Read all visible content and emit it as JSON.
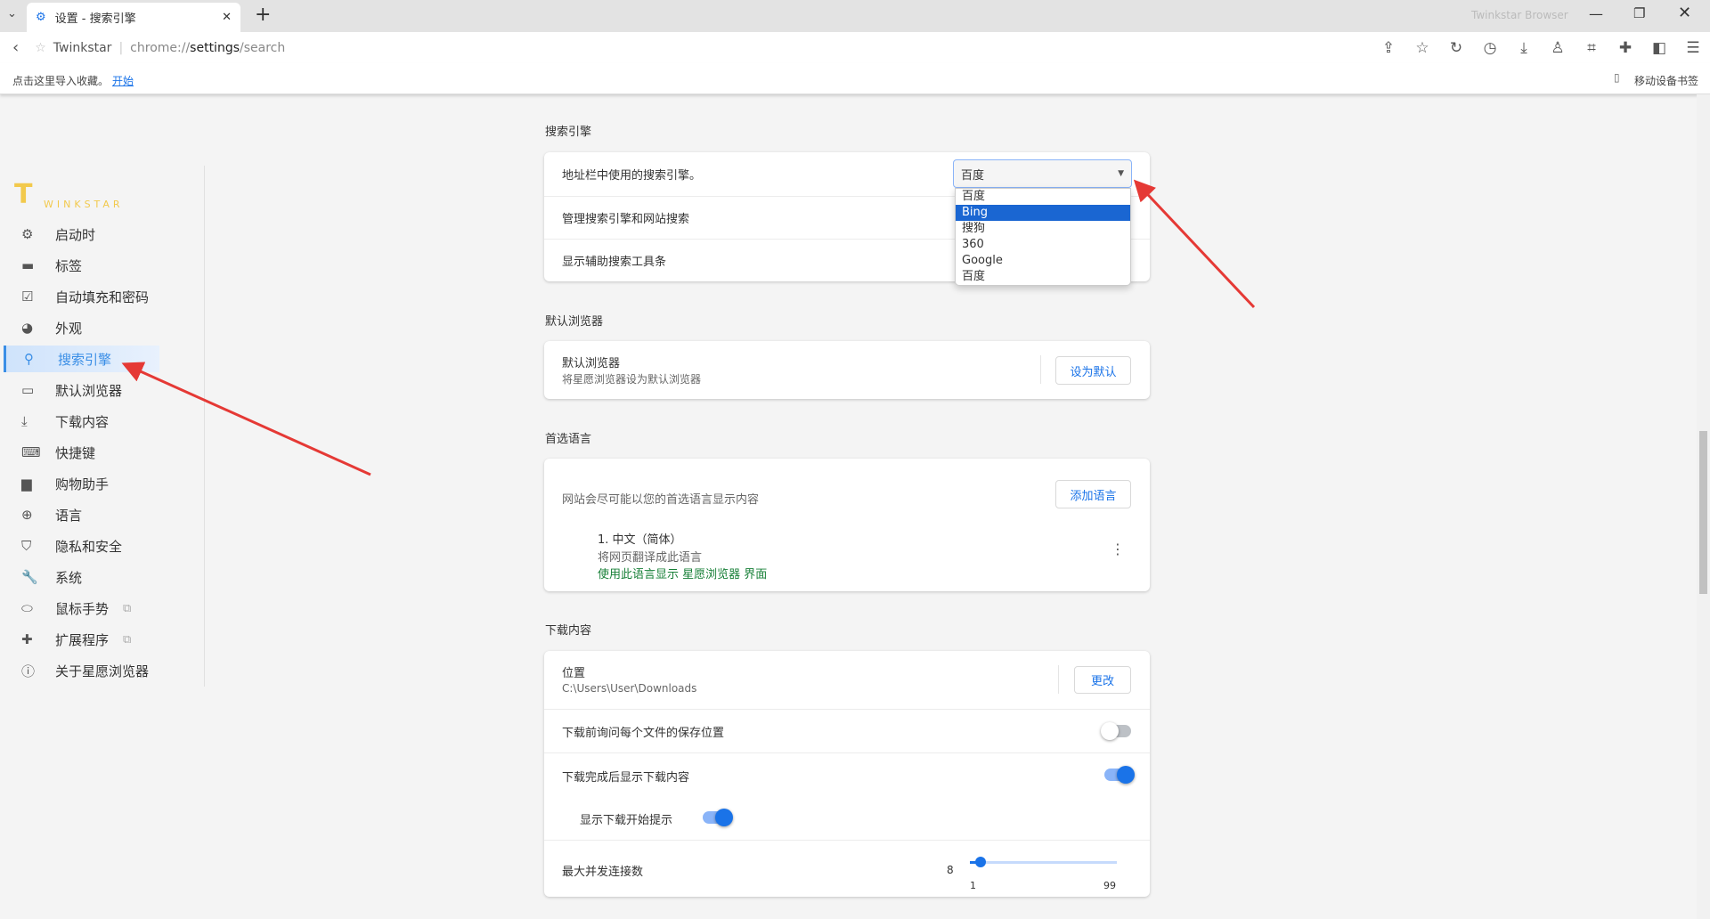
{
  "browser": {
    "tab_title": "设置 - 搜索引擎",
    "window_title": "Twinkstar Browser",
    "site_name": "Twinkstar",
    "url_prefix": "chrome://",
    "url_host": "settings",
    "url_path": "/search",
    "bookmark_prompt": "点击这里导入收藏。",
    "bookmark_link": "开始",
    "mobile_bookmarks": "移动设备书签"
  },
  "logo": "WINKSTAR",
  "sidebar": {
    "active": "搜索引擎",
    "items": [
      {
        "label": "启动时",
        "icon": "gear-icon",
        "glyph": "⚙"
      },
      {
        "label": "标签",
        "icon": "tab-icon",
        "glyph": "▬"
      },
      {
        "label": "自动填充和密码",
        "icon": "edit-icon",
        "glyph": "☑"
      },
      {
        "label": "外观",
        "icon": "palette-icon",
        "glyph": "◕"
      },
      {
        "label": "搜索引擎",
        "icon": "search-icon",
        "glyph": "⚲"
      },
      {
        "label": "默认浏览器",
        "icon": "browser-icon",
        "glyph": "▭"
      },
      {
        "label": "下载内容",
        "icon": "download-icon",
        "glyph": "⤓"
      },
      {
        "label": "快捷键",
        "icon": "keyboard-icon",
        "glyph": "⌨"
      },
      {
        "label": "购物助手",
        "icon": "bag-icon",
        "glyph": "▆"
      },
      {
        "label": "语言",
        "icon": "globe-icon",
        "glyph": "⊕"
      },
      {
        "label": "隐私和安全",
        "icon": "shield-icon",
        "glyph": "⛉"
      },
      {
        "label": "系统",
        "icon": "wrench-icon",
        "glyph": "🔧"
      },
      {
        "label": "鼠标手势",
        "icon": "mouse-icon",
        "glyph": "⬭",
        "external": true
      },
      {
        "label": "扩展程序",
        "icon": "puzzle-icon",
        "glyph": "✚",
        "external": true
      },
      {
        "label": "关于星愿浏览器",
        "icon": "info-icon",
        "glyph": "ⓘ"
      }
    ]
  },
  "search": {
    "title": "搜索引擎",
    "engine_label": "地址栏中使用的搜索引擎。",
    "engine_value": "百度",
    "manage": "管理搜索引擎和网站搜索",
    "toolbar": "显示辅助搜索工具条",
    "options": [
      "百度",
      "Bing",
      "搜狗",
      "360",
      "Google",
      "百度"
    ],
    "highlighted": "Bing"
  },
  "default_browser": {
    "title": "默认浏览器",
    "label": "默认浏览器",
    "desc": "将星愿浏览器设为默认浏览器",
    "button": "设为默认"
  },
  "language": {
    "title": "首选语言",
    "desc": "网站会尽可能以您的首选语言显示内容",
    "add_button": "添加语言",
    "item": "1. 中文（简体）",
    "translate": "将网页翻译成此语言",
    "ui_note": "使用此语言显示 星愿浏览器 界面"
  },
  "downloads": {
    "title": "下载内容",
    "location_label": "位置",
    "location": "C:\\Users\\User\\Downloads",
    "change_button": "更改",
    "ask_label": "下载前询问每个文件的保存位置",
    "ask": false,
    "show_after_label": "下载完成后显示下载内容",
    "show_after": true,
    "start_tip_label": "显示下载开始提示",
    "start_tip": true,
    "max_conn_label": "最大并发连接数",
    "max_conn_value": "8",
    "min": "1",
    "max": "99"
  },
  "colors": {
    "accent": "#1a73e8",
    "active_nav": "#3a8ee6",
    "green": "#188038",
    "annotation": "#e53935"
  }
}
